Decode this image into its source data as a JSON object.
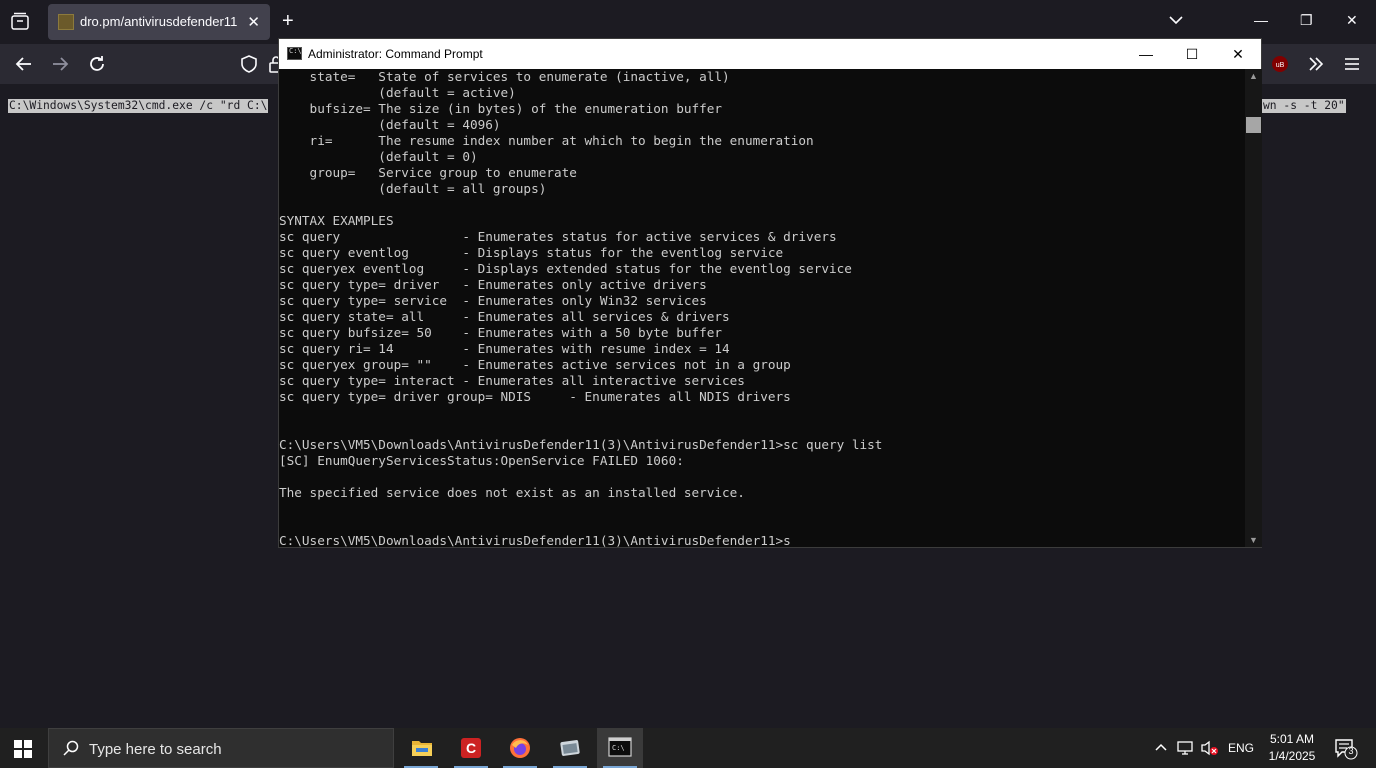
{
  "browser": {
    "tab_title": "dro.pm/antivirusdefender11",
    "selected_text_left": "C:\\Windows\\System32\\cmd.exe /c \"rd C:\\",
    "selected_text_right": "wn -s -t 20\""
  },
  "cmd": {
    "title": "Administrator: Command Prompt",
    "lines": [
      "    state=   State of services to enumerate (inactive, all)",
      "             (default = active)",
      "    bufsize= The size (in bytes) of the enumeration buffer",
      "             (default = 4096)",
      "    ri=      The resume index number at which to begin the enumeration",
      "             (default = 0)",
      "    group=   Service group to enumerate",
      "             (default = all groups)",
      "",
      "SYNTAX EXAMPLES",
      "sc query                - Enumerates status for active services & drivers",
      "sc query eventlog       - Displays status for the eventlog service",
      "sc queryex eventlog     - Displays extended status for the eventlog service",
      "sc query type= driver   - Enumerates only active drivers",
      "sc query type= service  - Enumerates only Win32 services",
      "sc query state= all     - Enumerates all services & drivers",
      "sc query bufsize= 50    - Enumerates with a 50 byte buffer",
      "sc query ri= 14         - Enumerates with resume index = 14",
      "sc queryex group= \"\"    - Enumerates active services not in a group",
      "sc query type= interact - Enumerates all interactive services",
      "sc query type= driver group= NDIS     - Enumerates all NDIS drivers",
      "",
      "",
      "C:\\Users\\VM5\\Downloads\\AntivirusDefender11(3)\\AntivirusDefender11>sc query list",
      "[SC] EnumQueryServicesStatus:OpenService FAILED 1060:",
      "",
      "The specified service does not exist as an installed service.",
      "",
      "",
      "C:\\Users\\VM5\\Downloads\\AntivirusDefender11(3)\\AntivirusDefender11>s"
    ]
  },
  "taskbar": {
    "search_placeholder": "Type here to search",
    "language": "ENG",
    "time": "5:01 AM",
    "date": "1/4/2025",
    "notification_count": "3"
  }
}
